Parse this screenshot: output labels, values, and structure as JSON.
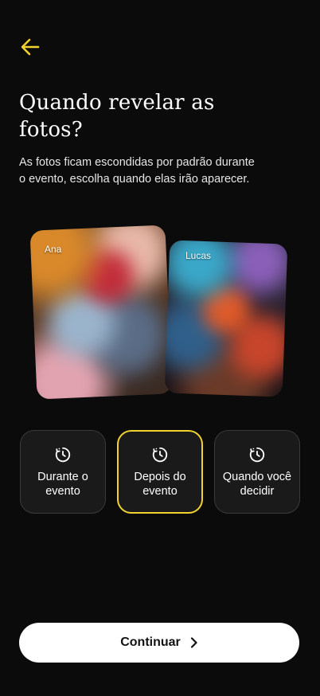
{
  "header": {
    "back_icon": "arrow-left-icon",
    "accent_color": "#F2D22E"
  },
  "title": "Quando revelar as fotos?",
  "subtitle": "As fotos ficam escondidas por padrão durante o evento, escolha quando elas irão aparecer.",
  "photos": [
    {
      "author": "Ana"
    },
    {
      "author": "Lucas"
    }
  ],
  "options": [
    {
      "label": "Durante o evento",
      "icon": "clock-history-icon",
      "selected": false
    },
    {
      "label": "Depois do evento",
      "icon": "clock-history-icon",
      "selected": true
    },
    {
      "label": "Quando você decidir",
      "icon": "clock-history-icon",
      "selected": false
    }
  ],
  "cta": {
    "label": "Continuar",
    "icon": "chevron-right-icon"
  },
  "colors": {
    "background": "#0B0B0B",
    "card": "#1A1A1A",
    "card_border": "#3A3A3A",
    "selected_border": "#F2D22E",
    "button_bg": "#FFFFFF"
  }
}
